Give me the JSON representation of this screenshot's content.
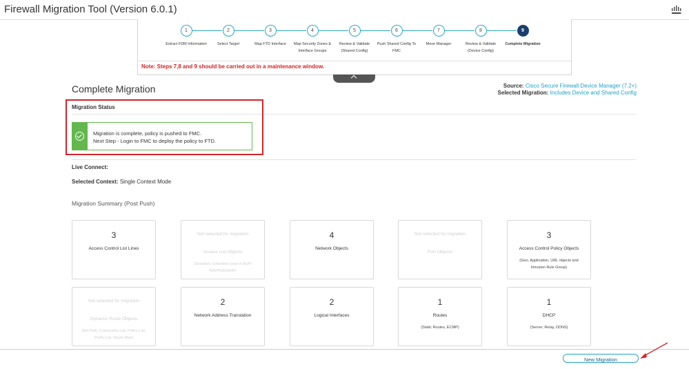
{
  "app": {
    "title": "Firewall Migration Tool (Version 6.0.1)",
    "logo_icon": "cisco-logo-icon"
  },
  "stepper": {
    "steps": [
      {
        "num": "1",
        "label": "Extract FDM Information"
      },
      {
        "num": "2",
        "label": "Select Target"
      },
      {
        "num": "3",
        "label": "Map FTD Interface"
      },
      {
        "num": "4",
        "label": "Map Security Zones &\nInterface Groups"
      },
      {
        "num": "5",
        "label": "Review & Validate\n(Shared Config)"
      },
      {
        "num": "6",
        "label": "Push Shared Config To\nFMC"
      },
      {
        "num": "7",
        "label": "Move Manager"
      },
      {
        "num": "8",
        "label": "Review & Validate\n(Device Config)"
      },
      {
        "num": "9",
        "label": "Complete Migration"
      }
    ],
    "active_step": 9,
    "note": "Note: Steps 7,8 and 9 should be carried out in a maintenance window."
  },
  "page": {
    "title": "Complete Migration",
    "source_label": "Source:",
    "source_value": "Cisco Secure Firewall Device Manager (7.2+)",
    "selected_migration_label": "Selected Migration:",
    "selected_migration_value": "Includes Device and Shared Config"
  },
  "migration_status": {
    "label": "Migration Status",
    "line1": "Migration is complete, policy is pushed to FMC.",
    "line2": "Next Step - Login to FMC to deploy the policy to FTD.",
    "icon": "check-circle-icon"
  },
  "live_connect": {
    "label": "Live Connect:"
  },
  "selected_context": {
    "label": "Selected Context:",
    "value": "Single Context Mode"
  },
  "summary": {
    "title": "Migration Summary (Post Push)",
    "cards": [
      {
        "count": "3",
        "label": "Access Control List Lines",
        "sub": "",
        "disabled": false
      },
      {
        "count": "",
        "label": "Access List Objects",
        "sub": "(Standard, Extended used in BGP/\nRAVPN/EIGRP)",
        "disabled": true,
        "not_selected": "Not selected for migration"
      },
      {
        "count": "4",
        "label": "Network Objects",
        "sub": "",
        "disabled": false
      },
      {
        "count": "",
        "label": "Port Objects",
        "sub": "",
        "disabled": true,
        "not_selected": "Not selected for migration"
      },
      {
        "count": "3",
        "label": "Access Control Policy Objects",
        "sub": "(Geo, Application, URL objects and\nIntrusion Rule Group)",
        "disabled": false
      },
      {
        "count": "",
        "label": "Dynamic Route Objects",
        "sub": "(AS-Path, Community-List, Policy-List,\nPrefix-List, Route-Map)",
        "disabled": true,
        "not_selected": "Not selected for migration"
      },
      {
        "count": "2",
        "label": "Network Address Translation",
        "sub": "",
        "disabled": false
      },
      {
        "count": "2",
        "label": "Logical Interfaces",
        "sub": "",
        "disabled": false
      },
      {
        "count": "1",
        "label": "Routes",
        "sub": "(Static Routes, ECMP)",
        "disabled": false
      },
      {
        "count": "1",
        "label": "DHCP",
        "sub": "(Server, Relay, DDNS)",
        "disabled": false
      }
    ]
  },
  "footer": {
    "new_migration_label": "New Migration"
  },
  "colors": {
    "accent": "#1ea3c9",
    "success": "#62b84d",
    "alert": "#d2232a",
    "active_step": "#1b3f6e"
  }
}
